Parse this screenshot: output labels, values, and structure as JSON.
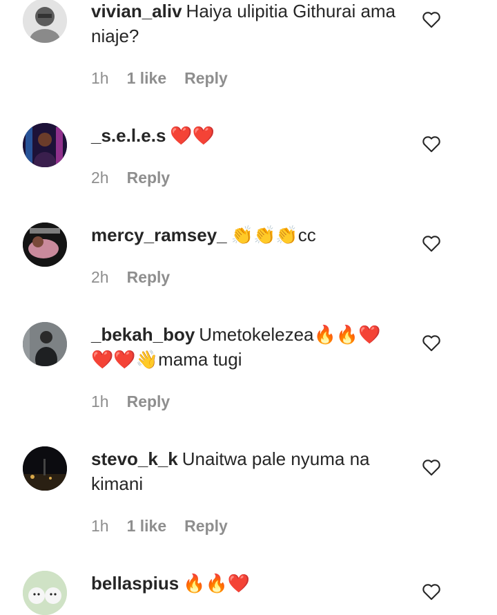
{
  "comments": [
    {
      "username": "vivian_aliv",
      "text": "Haiya ulipitia Githurai ama niaje?",
      "time": "1h",
      "likes": "1 like",
      "reply": "Reply",
      "avatar": {
        "bg": "#d8d8d8",
        "fg": "#555555"
      }
    },
    {
      "username": "_s.e.l.e.s",
      "text": "❤️❤️",
      "time": "2h",
      "likes": "",
      "reply": "Reply",
      "avatar": {
        "bg": "#1b1340",
        "fg": "#c23fb0"
      }
    },
    {
      "username": "mercy_ramsey_",
      "text": "👏👏👏cc",
      "time": "2h",
      "likes": "",
      "reply": "Reply",
      "avatar": {
        "bg": "#111111",
        "fg": "#c98a9c"
      }
    },
    {
      "username": "_bekah_boy",
      "text": "Umetokelezea🔥🔥❤️❤️❤️👋mama tugi",
      "time": "1h",
      "likes": "",
      "reply": "Reply",
      "avatar": {
        "bg": "#6d7275",
        "fg": "#1e2022"
      }
    },
    {
      "username": "stevo_k_k",
      "text": "Unaitwa pale nyuma na kimani",
      "time": "1h",
      "likes": "1 like",
      "reply": "Reply",
      "avatar": {
        "bg": "#0d0d12",
        "fg": "#d9a84a"
      }
    },
    {
      "username": "bellaspius",
      "text": "🔥🔥❤️",
      "time": "",
      "likes": "",
      "reply": "",
      "avatar": {
        "bg": "#cfe2c5",
        "fg": "#f4f4f4"
      }
    }
  ],
  "icons": {
    "like": "heart-outline-icon"
  }
}
